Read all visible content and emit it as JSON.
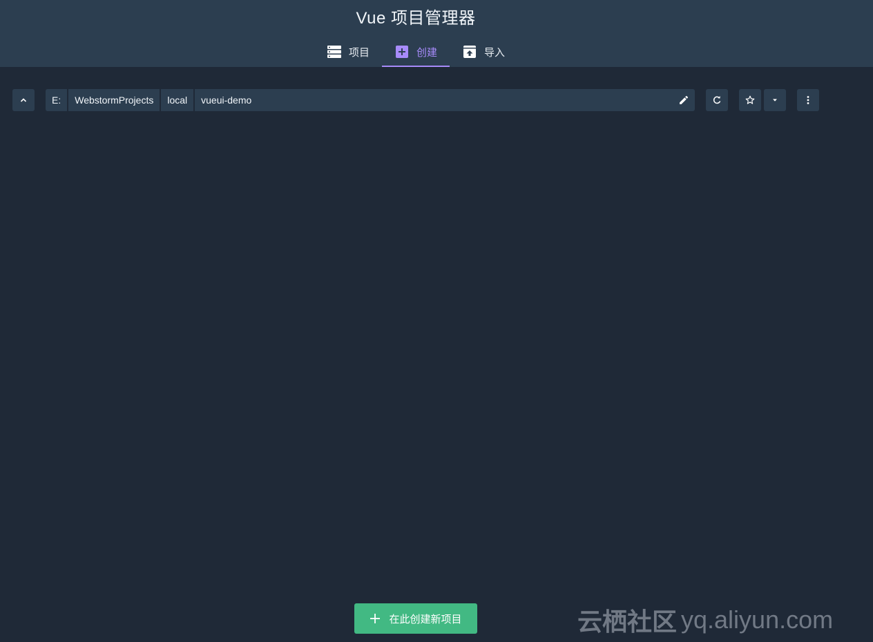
{
  "header": {
    "title": "Vue 项目管理器",
    "tabs": [
      {
        "label": "项目",
        "icon": "list-icon",
        "active": false
      },
      {
        "label": "创建",
        "icon": "add-box-icon",
        "active": true
      },
      {
        "label": "导入",
        "icon": "unarchive-icon",
        "active": false
      }
    ]
  },
  "toolbar": {
    "path_segments": [
      "E:",
      "WebstormProjects",
      "local",
      "vueui-demo"
    ],
    "icons": {
      "up": "chevron-up-icon",
      "edit": "pencil-icon",
      "refresh": "refresh-icon",
      "favorite": "star-icon",
      "favorites_menu": "caret-down-icon",
      "more": "more-vert-icon"
    }
  },
  "main": {
    "create_button_label": "在此创建新项目"
  },
  "watermark": {
    "cn": "云栖社区",
    "en": "yq.aliyun.com"
  },
  "colors": {
    "background": "#1f2937",
    "header": "#2c3e50",
    "accent": "#a78bfa",
    "primary": "#42b983"
  }
}
